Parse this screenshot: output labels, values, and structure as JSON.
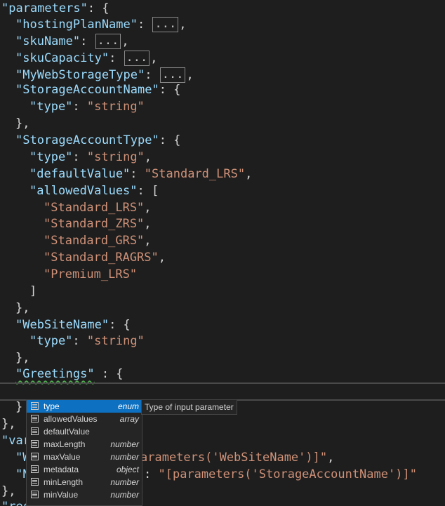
{
  "colors": {
    "background": "#1e1e1e",
    "key": "#9cdcfe",
    "string": "#ce9178",
    "punctuation": "#d4d4d4",
    "selection": "#0e70c0",
    "squiggle": "#4fb34f"
  },
  "code": {
    "l1_key": "\"parameters\"",
    "l1_rest": ": {",
    "l2_key": "\"hostingPlanName\"",
    "l2_sep": ": ",
    "l2_fold": "...",
    "l2_end": ",",
    "l3_key": "\"skuName\"",
    "l3_sep": ": ",
    "l3_fold": "...",
    "l3_end": ",",
    "l4_key": "\"skuCapacity\"",
    "l4_sep": ": ",
    "l4_fold": "...",
    "l4_end": ",",
    "l5_key": "\"MyWebStorageType\"",
    "l5_sep": ": ",
    "l5_fold": "...",
    "l5_end": ",",
    "l6_key": "\"StorageAccountName\"",
    "l6_rest": ": {",
    "l7_key": "\"type\"",
    "l7_sep": ": ",
    "l7_val": "\"string\"",
    "l8": "},",
    "l9_key": "\"StorageAccountType\"",
    "l9_rest": ": {",
    "l10_key": "\"type\"",
    "l10_sep": ": ",
    "l10_val": "\"string\"",
    "l10_end": ",",
    "l11_key": "\"defaultValue\"",
    "l11_sep": ": ",
    "l11_val": "\"Standard_LRS\"",
    "l11_end": ",",
    "l12_key": "\"allowedValues\"",
    "l12_rest": ": [",
    "l13_val": "\"Standard_LRS\"",
    "l13_end": ",",
    "l14_val": "\"Standard_ZRS\"",
    "l14_end": ",",
    "l15_val": "\"Standard_GRS\"",
    "l15_end": ",",
    "l16_val": "\"Standard_RAGRS\"",
    "l16_end": ",",
    "l17_val": "\"Premium_LRS\"",
    "l18": "]",
    "l19": "},",
    "l20_key": "\"WebSiteName\"",
    "l20_rest": ": {",
    "l21_key": "\"type\"",
    "l21_sep": ": ",
    "l21_val": "\"string\"",
    "l22": "},",
    "l23_key": "\"Greetings\"",
    "l23_rest": " : {",
    "l25": "}",
    "l26": "},",
    "l27_key": "\"var",
    "l28_key": "\"W",
    "l28_val": "arameters('WebSiteName')]\"",
    "l28_end": ",",
    "l29_key": "\"N",
    "l29_sep": ": ",
    "l29_val": "\"[parameters('StorageAccountName')]\"",
    "l30": "},",
    "l31_key": "\"resources\"",
    "l31_rest": ": ["
  },
  "suggest": {
    "items": [
      {
        "name": "type",
        "type": "enum",
        "icon": "property-icon"
      },
      {
        "name": "allowedValues",
        "type": "array",
        "icon": "property-icon"
      },
      {
        "name": "defaultValue",
        "type": "",
        "icon": "property-icon"
      },
      {
        "name": "maxLength",
        "type": "number",
        "icon": "property-icon"
      },
      {
        "name": "maxValue",
        "type": "number",
        "icon": "property-icon"
      },
      {
        "name": "metadata",
        "type": "object",
        "icon": "property-icon"
      },
      {
        "name": "minLength",
        "type": "number",
        "icon": "property-icon"
      },
      {
        "name": "minValue",
        "type": "number",
        "icon": "property-icon"
      }
    ],
    "doc": "Type of input parameter"
  }
}
